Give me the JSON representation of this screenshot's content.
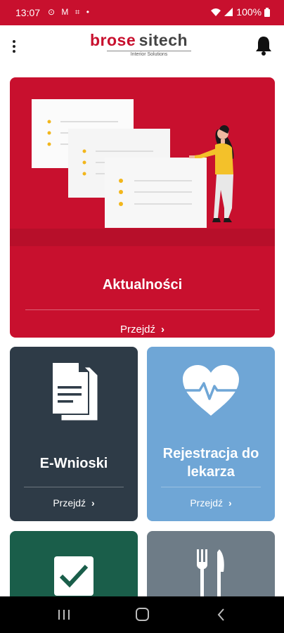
{
  "status_bar": {
    "time": "13:07",
    "left_icons": "⊙ M ⌗ •",
    "battery": "100%"
  },
  "header": {
    "logo_brand": "brose",
    "logo_brand2": "sitech",
    "logo_tagline": "Interior Solutions"
  },
  "cards": {
    "news": {
      "title": "Aktualności",
      "go_label": "Przejdź"
    },
    "wnioski": {
      "title": "E-Wnioski",
      "go_label": "Przejdź"
    },
    "lekarz": {
      "title_line1": "Rejestracja do",
      "title_line2": "lekarza",
      "go_label": "Przejdź"
    }
  },
  "colors": {
    "brand_red": "#c8102e",
    "dark_card": "#2e3b47",
    "blue_card": "#6fa6d6",
    "green_card": "#1a5e4a",
    "grey_card": "#6e7c87"
  }
}
